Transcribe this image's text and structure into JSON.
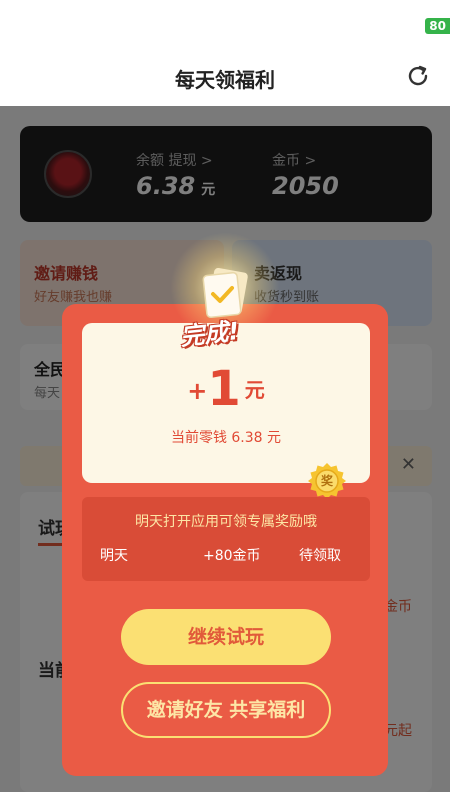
{
  "status": {
    "battery": "80"
  },
  "header": {
    "title": "每天领福利"
  },
  "wallet": {
    "balance_label": "余额 提现 >",
    "balance_value": "6.38",
    "balance_unit": "元",
    "coins_label": "金币 >",
    "coins_value": "2050"
  },
  "promos": [
    {
      "title": "邀请赚钱",
      "sub": "好友赚我也赚"
    },
    {
      "title": "卖返现",
      "sub": "收货秒到账"
    }
  ],
  "mini_card": {
    "title": "全民",
    "sub": "每天"
  },
  "list": {
    "tab": "试玩",
    "right_1": "金币",
    "heading": "当前",
    "right_2": "元起"
  },
  "modal": {
    "badge": "完成!",
    "reward_plus": "+",
    "reward_amount": "1",
    "reward_unit": "元",
    "balance_text": "当前零钱 6.38 元",
    "tomorrow_message": "明天打开应用可领专属奖励哦",
    "tomorrow_day": "明天",
    "tomorrow_reward": "+80金币",
    "tomorrow_status": "待领取",
    "medal_char": "奖",
    "continue_label": "继续试玩",
    "invite_label": "邀请好友 共享福利"
  },
  "colors": {
    "modal_bg": "#ea5b45",
    "accent_yellow": "#fbe073",
    "reward_red": "#e14a35",
    "card_cream": "#fdf7e6"
  }
}
